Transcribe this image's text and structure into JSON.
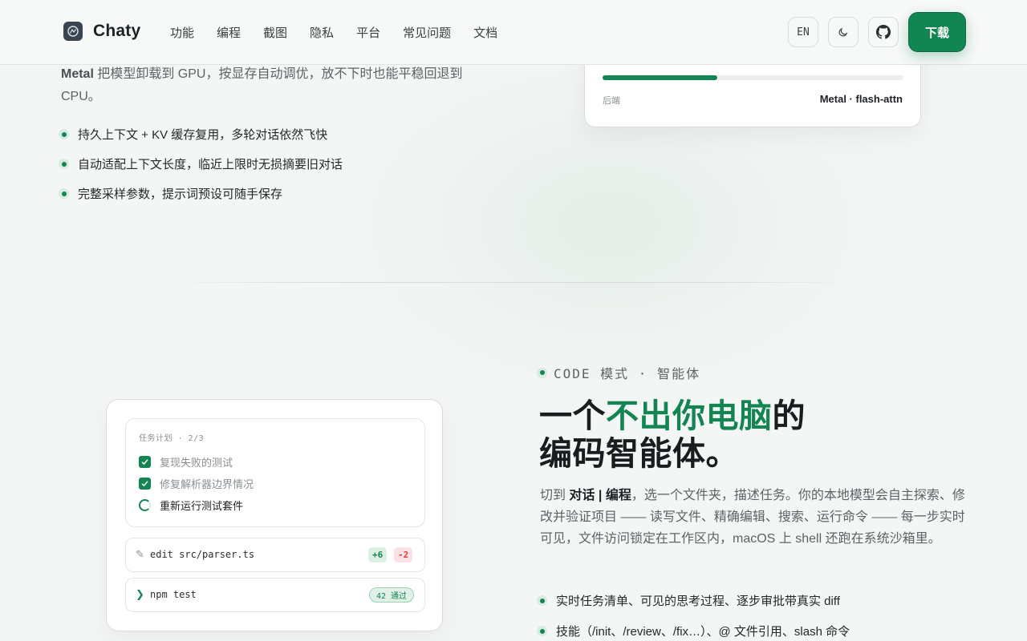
{
  "nav": {
    "brand": "Chaty",
    "links": [
      "功能",
      "编程",
      "截图",
      "隐私",
      "平台",
      "常见问题",
      "文档"
    ],
    "lang_button": "EN",
    "download_label": "下载"
  },
  "top_section": {
    "desc_lead": "Metal",
    "desc_rest": " 把模型卸载到 GPU，按显存自动调优，放不下时也能平稳回退到 CPU。",
    "bullets": [
      "持久上下文 + KV 缓存复用，多轮对话依然飞快",
      "自动适配上下文长度，临近上限时无损摘要旧对话",
      "完整采样参数，提示词预设可随手保存"
    ],
    "card": {
      "progress_fraction": 0.38,
      "backend_label": "后端",
      "backend_value": "Metal · flash-attn"
    }
  },
  "code_section": {
    "eyebrow": "CODE 模式 · 智能体",
    "headline_prefix": "一个",
    "headline_accent": "不出你电脑",
    "headline_suffix": "的",
    "headline_line2": "编码智能体。",
    "desc_prefix": "切到 ",
    "desc_bold": "对话 | 编程",
    "desc_rest": "，选一个文件夹，描述任务。你的本地模型会自主探索、修改并验证项目 —— 读写文件、精确编辑、搜索、运行命令 —— 每一步实时可见，文件访问锁定在工作区内，macOS 上 shell 还跑在系统沙箱里。",
    "bullets": [
      "实时任务清单、可见的思考过程、逐步审批带真实 diff",
      "技能（/init、/review、/fix…）、@ 文件引用、slash 命令"
    ],
    "card": {
      "plan_title": "任务计划 · 2/3",
      "tasks": [
        {
          "label": "复现失败的测试",
          "status": "done"
        },
        {
          "label": "修复解析器边界情况",
          "status": "done"
        },
        {
          "label": "重新运行测试套件",
          "status": "running"
        }
      ],
      "edit_icon": "✎",
      "edit_text": "edit src/parser.ts",
      "added": "+6",
      "removed": "-2",
      "cmd_icon": "❯",
      "cmd_text": "npm test",
      "pass_badge": "42 通过"
    }
  },
  "colors": {
    "accent": "#138553",
    "accent_soft": "#d7ebe0",
    "danger": "#d8403f"
  }
}
